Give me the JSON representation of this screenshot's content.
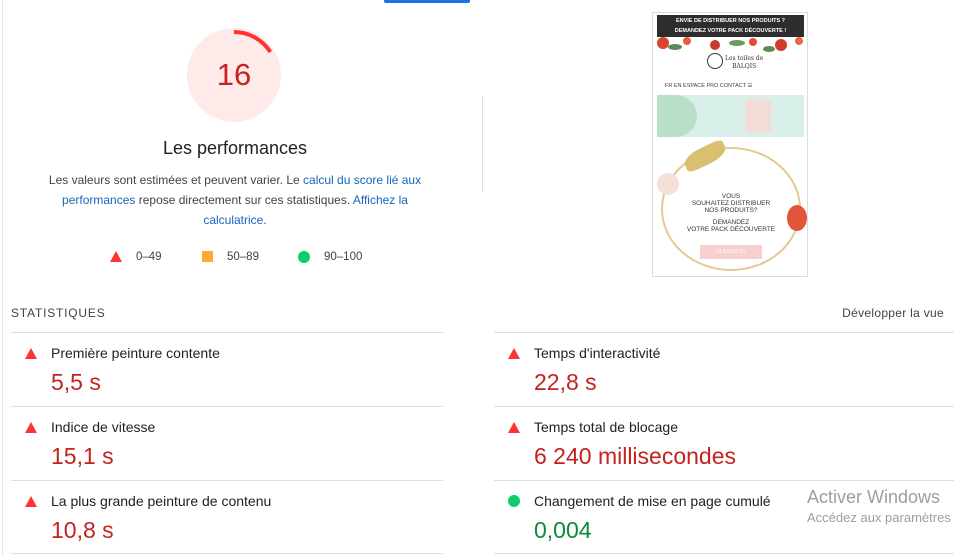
{
  "score": {
    "value": "16",
    "fraction": 0.16,
    "color": "#c5221f",
    "ring_color": "#ff3333",
    "bg_color": "#ffeaea"
  },
  "performance": {
    "title": "Les performances",
    "desc_part1": "Les valeurs sont estimées et peuvent varier. Le ",
    "link1": "calcul du score lié aux performances",
    "desc_part2": " repose directement sur ces statistiques. ",
    "link2": "Affichez la calculatrice",
    "desc_part3": "."
  },
  "legend": [
    {
      "shape": "triangle",
      "label": "0–49",
      "color": "#ff3333"
    },
    {
      "shape": "square",
      "label": "50–89",
      "color": "#ffaa33"
    },
    {
      "shape": "circle",
      "label": "90–100",
      "color": "#0cce6b"
    }
  ],
  "thumbnail": {
    "banner_line1": "ENVIE DE DISTRIBUER NOS PRODUITS ?",
    "banner_line2": "DEMANDEZ VOTRE PACK DÉCOUVERTE !",
    "logo_line1": "Les toiles de",
    "logo_line2": "BALQIS",
    "nav": "FR  EN    ESPACE PRO    CONTACT  ☰",
    "copy_line1": "VOUS",
    "copy_line2": "SOUHAITEZ DISTRIBUER",
    "copy_line3": "NOS PRODUITS?",
    "copy_line4": "DEMANDEZ",
    "copy_line5": "VOTRE PACK DÉCOUVERTE",
    "button": "CLIQUEZ ICI"
  },
  "stats": {
    "title": "STATISTIQUES",
    "expand": "Développer la vue"
  },
  "metrics": [
    {
      "label": "Première peinture contente",
      "value": "5,5 s",
      "status": "fail"
    },
    {
      "label": "Temps d'interactivité",
      "value": "22,8 s",
      "status": "fail"
    },
    {
      "label": "Indice de vitesse",
      "value": "15,1 s",
      "status": "fail"
    },
    {
      "label": "Temps total de blocage",
      "value": "6 240 millisecondes",
      "status": "fail"
    },
    {
      "label": "La plus grande peinture de contenu",
      "value": "10,8 s",
      "status": "fail"
    },
    {
      "label": "Changement de mise en page cumulé",
      "value": "0,004",
      "status": "pass"
    }
  ],
  "watermark": {
    "line1": "Activer Windows",
    "line2": "Accédez aux paramètres"
  }
}
